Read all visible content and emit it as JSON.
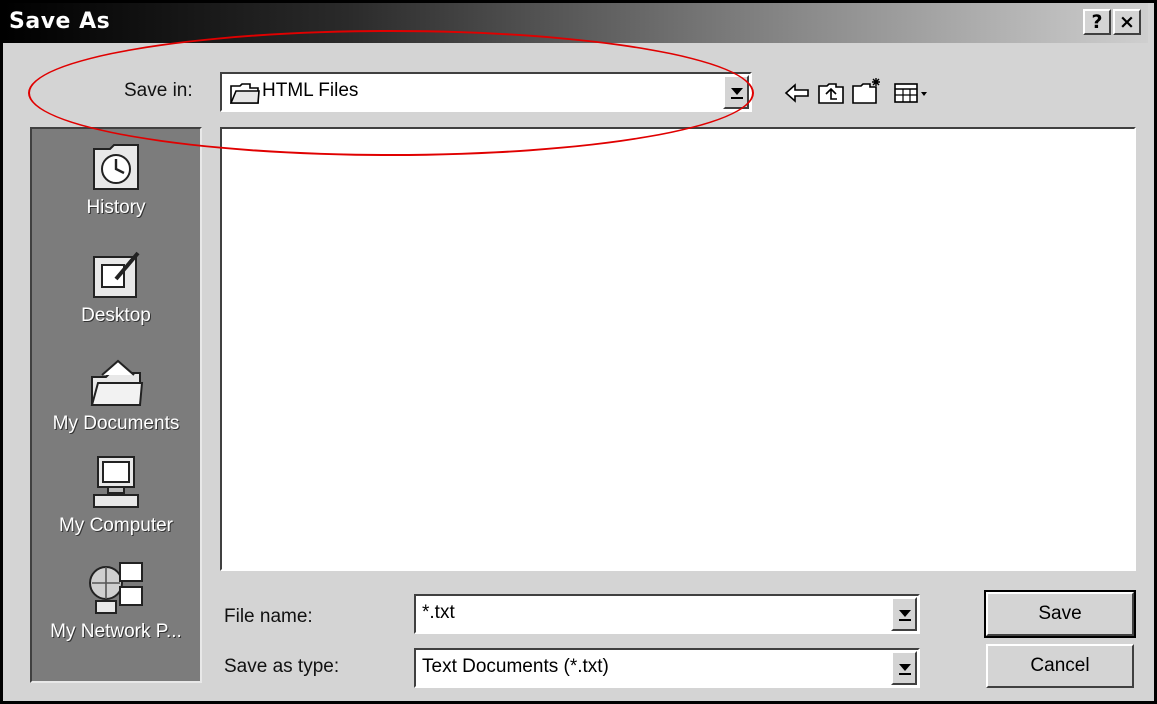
{
  "window": {
    "title": "Save As",
    "help_label": "?",
    "close_label": "×"
  },
  "save_in": {
    "label": "Save in:",
    "value": "HTML Files"
  },
  "toolbar": [
    "back-icon",
    "up-folder-icon",
    "new-folder-icon",
    "view-menu-icon"
  ],
  "places": [
    {
      "label": "History",
      "icon": "history-icon"
    },
    {
      "label": "Desktop",
      "icon": "desktop-icon"
    },
    {
      "label": "My Documents",
      "icon": "my-documents-icon"
    },
    {
      "label": "My Computer",
      "icon": "my-computer-icon"
    },
    {
      "label": "My Network P...",
      "icon": "network-places-icon"
    }
  ],
  "file_name": {
    "label": "File name:",
    "value": "*.txt"
  },
  "save_as_type": {
    "label": "Save as type:",
    "value": "Text Documents (*.txt)"
  },
  "buttons": {
    "save": "Save",
    "cancel": "Cancel"
  },
  "colors": {
    "annotation": "#e00000",
    "dialog_face": "#d4d4d4",
    "places_bar": "#7c7c7c"
  }
}
